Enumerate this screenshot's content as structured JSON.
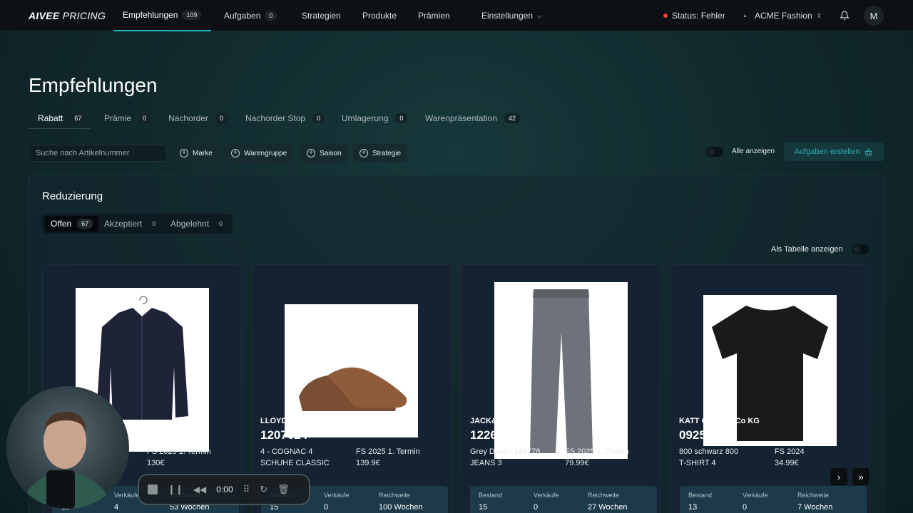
{
  "app": {
    "logo": "AIVEE",
    "logo_suffix": "PRICING"
  },
  "nav": {
    "items": [
      {
        "label": "Empfehlungen",
        "count": "109"
      },
      {
        "label": "Aufgaben",
        "count": "0"
      },
      {
        "label": "Strategien"
      },
      {
        "label": "Produkte"
      },
      {
        "label": "Prämien"
      },
      {
        "label": "Einstellungen"
      }
    ],
    "status": "Status: Fehler",
    "company": "ACME Fashion",
    "avatar": "M"
  },
  "page": {
    "title": "Empfehlungen"
  },
  "tabs": [
    {
      "label": "Rabatt",
      "count": "67"
    },
    {
      "label": "Prämie",
      "count": "0"
    },
    {
      "label": "Nachorder",
      "count": "0"
    },
    {
      "label": "Nachorder Stop",
      "count": "0"
    },
    {
      "label": "Umlagerung",
      "count": "0"
    },
    {
      "label": "Warenpräsentation",
      "count": "42"
    }
  ],
  "filters": {
    "search_placeholder": "Suche nach Artikelnummer",
    "buttons": [
      "Marke",
      "Warengruppe",
      "Saison",
      "Strategie"
    ],
    "show_all": "Alle anzeigen",
    "create_tasks": "Aufgaben erstellen"
  },
  "panel": {
    "title": "Reduzierung",
    "segments": [
      {
        "label": "Offen",
        "count": "67"
      },
      {
        "label": "Akzeptiert",
        "count": "0"
      },
      {
        "label": "Abgelehnt",
        "count": "0"
      }
    ],
    "table_toggle": "Als Tabelle anzeigen"
  },
  "cards": [
    {
      "brand": "",
      "number": "",
      "variant": "",
      "category": "",
      "season": "FS 2025 1. Termin",
      "price": "130€",
      "stats": {
        "bestand": "15",
        "verkaeufe": "4",
        "reichweite": "53 Wochen"
      }
    },
    {
      "brand": "LLOYD Shoes GmbH",
      "number": "1207624",
      "variant": "4 - COGNAC 4",
      "category": "SCHUHE CLASSIC",
      "season": "FS 2025 1. Termin",
      "price": "139.9€",
      "stats": {
        "bestand": "15",
        "verkaeufe": "0",
        "reichweite": "100 Wochen"
      }
    },
    {
      "brand": "JACK&JONES",
      "number": "12268245",
      "variant": "Grey Denim 188778",
      "category": "JEANS 3",
      "season": "FS 2025 1. Termin",
      "price": "79.99€",
      "stats": {
        "bestand": "15",
        "verkaeufe": "0",
        "reichweite": "27 Wochen"
      }
    },
    {
      "brand": "KATT GmbH & Co KG",
      "number": "092500",
      "variant": "800 schwarz 800",
      "category": "T-SHIRT 4",
      "season": "FS 2024",
      "price": "34.99€",
      "stats": {
        "bestand": "13",
        "verkaeufe": "0",
        "reichweite": "7 Wochen"
      }
    }
  ],
  "stat_labels": {
    "bestand": "Bestand",
    "verkaeufe": "Verkäufe",
    "reichweite": "Reichweite"
  },
  "pager": {
    "next": "›",
    "last": "»"
  },
  "recorder": {
    "time": "0:00"
  },
  "colors": {
    "accent": "#25b3b8",
    "error": "#e4453c"
  }
}
